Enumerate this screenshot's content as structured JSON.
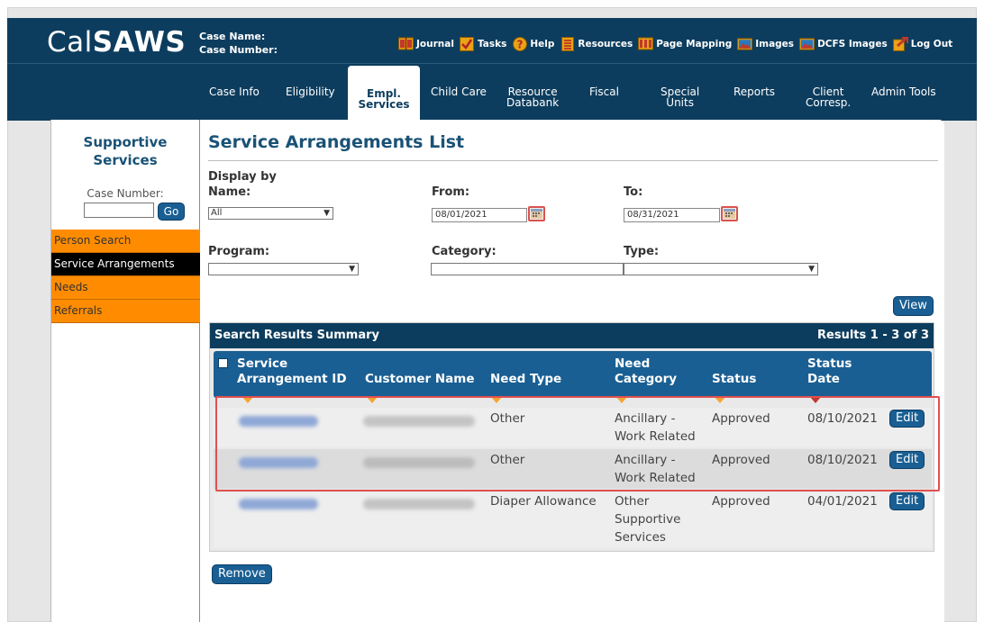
{
  "app": {
    "logo_light": "Cal",
    "logo_bold": "SAWS"
  },
  "case": {
    "name_label": "Case Name:",
    "number_label": "Case Number:"
  },
  "top_links": [
    {
      "label": "Journal",
      "icon": "book-icon",
      "color": "#e8a317"
    },
    {
      "label": "Tasks",
      "icon": "checkbox-icon",
      "color": "#e8a317"
    },
    {
      "label": "Help",
      "icon": "help-icon",
      "color": "#e8a317"
    },
    {
      "label": "Resources",
      "icon": "document-icon",
      "color": "#e8a317"
    },
    {
      "label": "Page Mapping",
      "icon": "map-book-icon",
      "color": "#e8a317"
    },
    {
      "label": "Images",
      "icon": "image-icon",
      "color": "#e8a317"
    },
    {
      "label": "DCFS Images",
      "icon": "image-icon",
      "color": "#e8a317"
    },
    {
      "label": "Log Out",
      "icon": "logout-icon",
      "color": "#e8a317"
    }
  ],
  "nav_tabs": [
    {
      "label": "Case Info"
    },
    {
      "label": "Eligibility"
    },
    {
      "label": "Empl.",
      "label2": "Services",
      "active": true
    },
    {
      "label": "Child Care"
    },
    {
      "label": "Resource",
      "label2": "Databank"
    },
    {
      "label": "Fiscal"
    },
    {
      "label": "Special",
      "label2": "Units"
    },
    {
      "label": "Reports"
    },
    {
      "label": "Client",
      "label2": "Corresp."
    },
    {
      "label": "Admin Tools"
    }
  ],
  "sidebar": {
    "title1": "Supportive",
    "title2": "Services",
    "case_label": "Case Number:",
    "case_value": "",
    "go_label": "Go",
    "items": [
      {
        "label": "Person Search"
      },
      {
        "label": "Service Arrangements",
        "active": true
      },
      {
        "label": "Needs"
      },
      {
        "label": "Referrals"
      }
    ]
  },
  "main": {
    "title": "Service Arrangements List",
    "display_by": "Display by",
    "name_label": "Name:",
    "name_value": "All",
    "from_label": "From:",
    "from_value": "08/01/2021",
    "to_label": "To:",
    "to_value": "08/31/2021",
    "program_label": "Program:",
    "program_value": "",
    "category_label": "Category:",
    "category_value": "",
    "type_label": "Type:",
    "type_value": "",
    "view_label": "View",
    "remove_label": "Remove"
  },
  "results": {
    "title": "Search Results Summary",
    "range": "Results 1 - 3 of 3",
    "columns": {
      "service": "Service",
      "arrangement_id": "Arrangement ID",
      "customer_name": "Customer Name",
      "need_type": "Need Type",
      "need": "Need",
      "category": "Category",
      "status": "Status",
      "status_top": "Status",
      "date": "Date"
    },
    "rows": [
      {
        "need_type": "Other",
        "need_cat_1": "Ancillary -",
        "need_cat_2": "Work Related",
        "need_cat_3": "",
        "status": "Approved",
        "date": "08/10/2021",
        "edit": "Edit"
      },
      {
        "need_type": "Other",
        "need_cat_1": "Ancillary -",
        "need_cat_2": "Work Related",
        "need_cat_3": "",
        "status": "Approved",
        "date": "08/10/2021",
        "edit": "Edit"
      },
      {
        "need_type": "Diaper Allowance",
        "need_cat_1": "Other",
        "need_cat_2": "Supportive",
        "need_cat_3": "Services",
        "status": "Approved",
        "date": "04/01/2021",
        "edit": "Edit"
      }
    ]
  },
  "colors": {
    "header_navy": "#0d3d5e",
    "button_blue": "#1a5f93",
    "sidebar_orange": "#ff8c00",
    "highlight_red": "#e05050",
    "title_blue": "#1a5276"
  }
}
